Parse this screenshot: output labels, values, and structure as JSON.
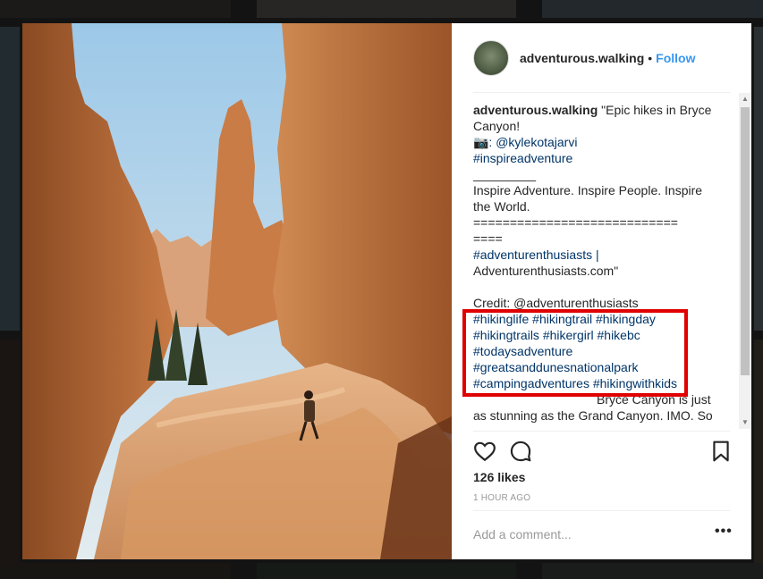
{
  "post": {
    "username": "adventurous.walking",
    "separator": "•",
    "follow_label": "Follow",
    "likes": "126 likes",
    "time": "1 HOUR AGO",
    "comment_placeholder": "Add a comment...",
    "more_label": "•••"
  },
  "caption": {
    "username": "adventurous.walking",
    "lines": [
      " \"Epic hikes in Bryce",
      "Canyon!",
      "📷: @kylekotajarvi",
      "#inspireadventure",
      "_________",
      "Inspire Adventure. Inspire People. Inspire",
      "the World.",
      "============================",
      "====",
      "#adventurenthusiasts |",
      "Adventurenthusiasts.com\"",
      "",
      "Credit: @adventurenthusiasts",
      "#hikinglife #hikingtrail #hikingday",
      "#hikingtrails #hikergirl #hikebc",
      "#todaysadventure",
      "#greatsanddunesnationalpark",
      "#campingadventures #hikingwithkids",
      "",
      "as stunning as the Grand Canyon. IMO. So"
    ],
    "partial_line": "Bryce Canyon is just"
  },
  "icons": {
    "like": "heart-icon",
    "comment": "comment-icon",
    "save": "bookmark-icon",
    "scroll_up": "▲",
    "scroll_down": "▼"
  },
  "colors": {
    "link": "#003569",
    "follow": "#3897f0",
    "highlight": "#e00000"
  }
}
